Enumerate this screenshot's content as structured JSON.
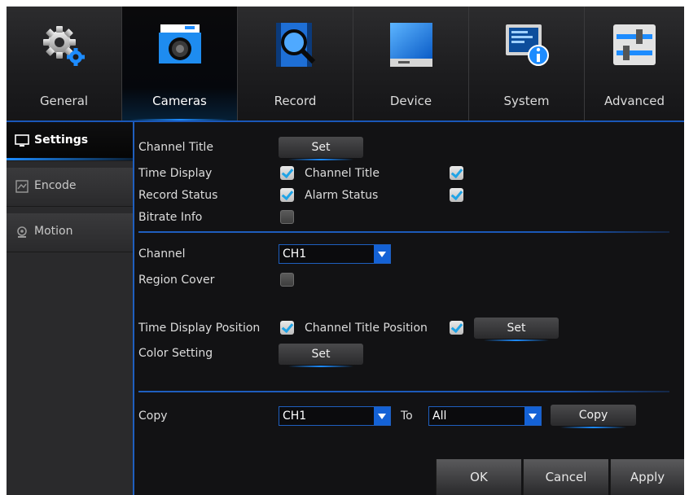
{
  "tabs": [
    {
      "label": "General",
      "icon": "gear-icon"
    },
    {
      "label": "Cameras",
      "icon": "camera-icon",
      "active": true
    },
    {
      "label": "Record",
      "icon": "record-search-icon"
    },
    {
      "label": "Device",
      "icon": "hard-drive-icon"
    },
    {
      "label": "System",
      "icon": "system-info-icon"
    },
    {
      "label": "Advanced",
      "icon": "sliders-icon"
    }
  ],
  "sidebar": {
    "items": [
      {
        "label": "Settings",
        "icon": "monitor-icon",
        "active": true
      },
      {
        "label": "Encode",
        "icon": "encode-icon"
      },
      {
        "label": "Motion",
        "icon": "motion-pin-icon"
      }
    ]
  },
  "settings": {
    "channel_title_label": "Channel Title",
    "channel_title_set": "Set",
    "time_display_label": "Time Display",
    "time_display_checked": true,
    "channel_title_check_label": "Channel Title",
    "channel_title_checked": true,
    "record_status_label": "Record Status",
    "record_status_checked": true,
    "alarm_status_label": "Alarm Status",
    "alarm_status_checked": true,
    "bitrate_info_label": "Bitrate Info",
    "bitrate_info_checked": false,
    "channel_label": "Channel",
    "channel_value": "CH1",
    "region_cover_label": "Region Cover",
    "region_cover_checked": false,
    "time_display_position_label": "Time Display Position",
    "time_display_position_checked": true,
    "channel_title_position_label": "Channel Title Position",
    "channel_title_position_checked": true,
    "position_set": "Set",
    "color_setting_label": "Color Setting",
    "color_setting_set": "Set",
    "copy_label": "Copy",
    "copy_from_value": "CH1",
    "to_label": "To",
    "copy_to_value": "All",
    "copy_button": "Copy"
  },
  "footer": {
    "ok": "OK",
    "cancel": "Cancel",
    "apply": "Apply"
  },
  "colors": {
    "accent": "#1d8cff",
    "check": "#1fa3e6",
    "background": "#121214"
  }
}
